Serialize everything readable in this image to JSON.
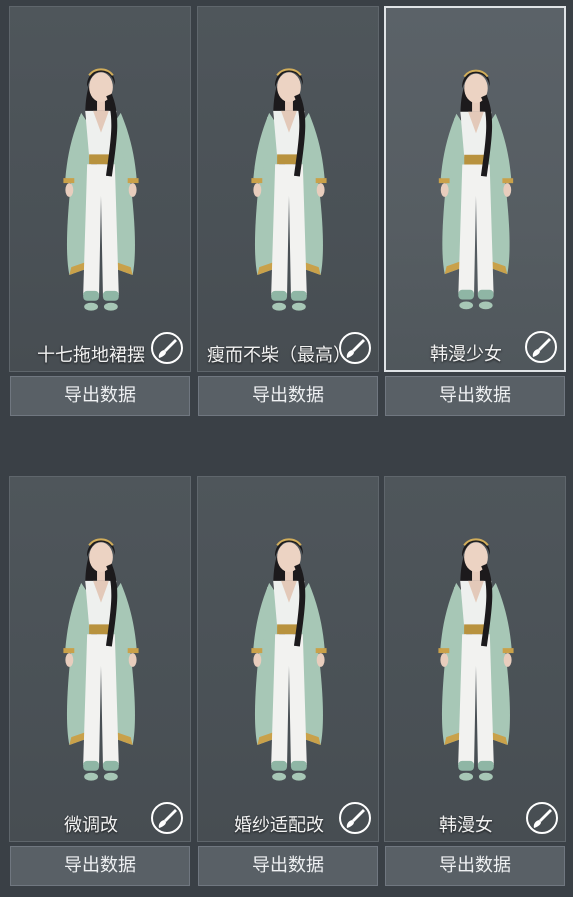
{
  "presets": [
    {
      "name": "十七拖地裙摆",
      "export_label": "导出数据",
      "selected": false
    },
    {
      "name": "瘦而不柴（最高）",
      "export_label": "导出数据",
      "selected": false
    },
    {
      "name": "韩漫少女",
      "export_label": "导出数据",
      "selected": true
    },
    {
      "name": "微调改",
      "export_label": "导出数据",
      "selected": false
    },
    {
      "name": "婚纱适配改",
      "export_label": "导出数据",
      "selected": false
    },
    {
      "name": "韩漫女",
      "export_label": "导出数据",
      "selected": false
    }
  ],
  "icons": {
    "edit": "brush-icon"
  },
  "colors": {
    "background": "#3a4046",
    "card": "#4f565b",
    "button": "#596066",
    "outfit_teal": "#a9c9b8",
    "outfit_gold": "#c9a14a"
  }
}
